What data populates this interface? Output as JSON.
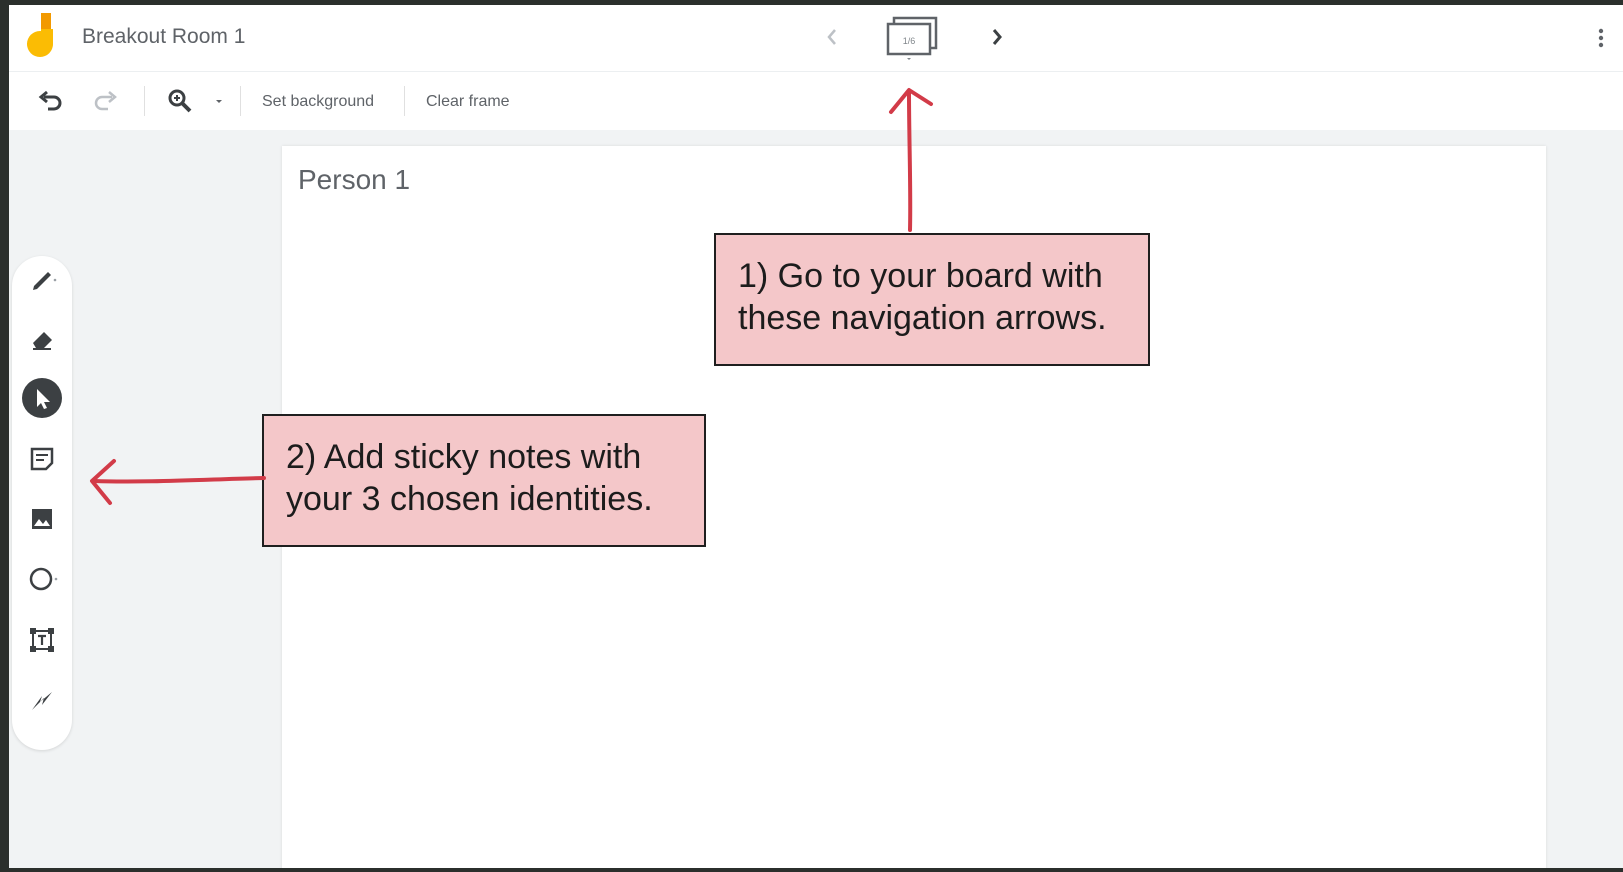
{
  "header": {
    "title": "Breakout Room 1",
    "frame_counter": "1/6",
    "icons": {
      "logo": "jamboard-logo",
      "prev": "chevron-left-icon",
      "next": "chevron-right-icon",
      "frames": "frame-bar-icon",
      "more": "more-vert-icon"
    }
  },
  "toolbar": {
    "set_background_label": "Set background",
    "clear_frame_label": "Clear frame",
    "icons": [
      "undo-icon",
      "redo-icon",
      "zoom-icon",
      "zoom-dropdown-icon"
    ]
  },
  "side_tools": [
    {
      "name": "pen-icon"
    },
    {
      "name": "eraser-icon"
    },
    {
      "name": "select-icon",
      "active": true
    },
    {
      "name": "sticky-note-icon"
    },
    {
      "name": "image-icon"
    },
    {
      "name": "circle-icon"
    },
    {
      "name": "text-box-icon"
    },
    {
      "name": "laser-icon"
    }
  ],
  "canvas": {
    "frame_title": "Person 1"
  },
  "annotations": {
    "callout_1": "1) Go to your board with these navigation arrows.",
    "callout_2": "2) Add sticky notes with your 3 chosen identities."
  },
  "colors": {
    "accent_active": "#3c4043",
    "callout_fill": "#f4c7c9",
    "arrow_red": "#d23b48",
    "logo_yellow": "#fbbc04",
    "logo_orange": "#f29900"
  }
}
